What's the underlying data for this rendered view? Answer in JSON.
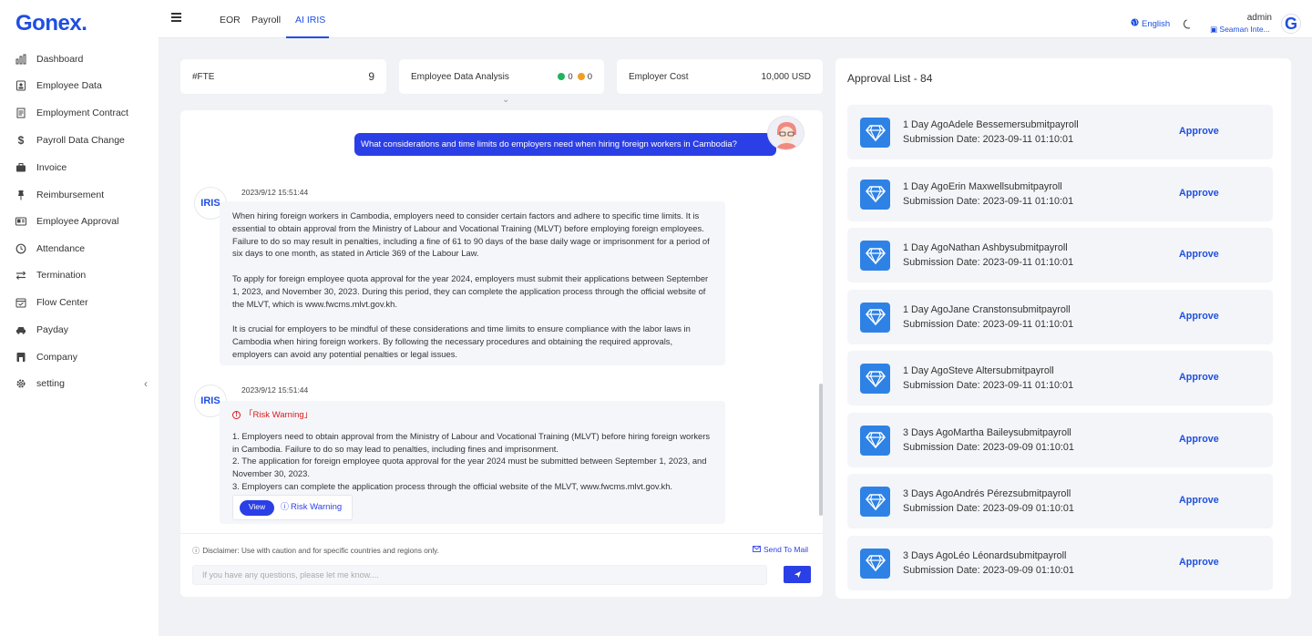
{
  "brand": {
    "name": "Gonex",
    "dot": "."
  },
  "sidebar": {
    "items": [
      {
        "label": "Dashboard",
        "icon": "bar-chart-icon"
      },
      {
        "label": "Employee Data",
        "icon": "id-card-icon"
      },
      {
        "label": "Employment Contract",
        "icon": "document-icon"
      },
      {
        "label": "Payroll Data Change",
        "icon": "dollar-icon"
      },
      {
        "label": "Invoice",
        "icon": "briefcase-icon"
      },
      {
        "label": "Reimbursement",
        "icon": "pin-icon"
      },
      {
        "label": "Employee Approval",
        "icon": "contact-card-icon"
      },
      {
        "label": "Attendance",
        "icon": "clock-icon"
      },
      {
        "label": "Termination",
        "icon": "swap-icon"
      },
      {
        "label": "Flow Center",
        "icon": "calendar-check-icon"
      },
      {
        "label": "Payday",
        "icon": "car-icon"
      },
      {
        "label": "Company",
        "icon": "building-icon"
      },
      {
        "label": "setting",
        "icon": "gear-icon"
      }
    ],
    "collapse_glyph": "‹"
  },
  "topbar": {
    "tabs": [
      {
        "label": "EOR"
      },
      {
        "label": "Payroll"
      },
      {
        "label": "AI IRIS",
        "active": true
      }
    ],
    "language": "English",
    "user_name": "admin",
    "user_company": "Seaman Inte...",
    "avatar_letter": "G"
  },
  "stats": {
    "fte_label": "#FTE",
    "fte_value": "9",
    "analysis_label": "Employee Data Analysis",
    "green_count": "0",
    "orange_count": "0",
    "cost_label": "Employer Cost",
    "cost_value": "10,000 USD",
    "expand_glyph": "⌄"
  },
  "chat": {
    "question": "What considerations and time limits do employers need when hiring foreign workers in Cambodia?",
    "bot_name": "IRIS",
    "messages": [
      {
        "timestamp": "2023/9/12 15:51:44",
        "paragraphs": [
          "When hiring foreign workers in Cambodia, employers need to consider certain factors and adhere to specific time limits. It is essential to obtain approval from the Ministry of Labour and Vocational Training (MLVT) before employing foreign employees. Failure to do so may result in penalties, including a fine of 61 to 90 days of the base daily wage or imprisonment for a period of six days to one month, as stated in Article 369 of the Labour Law.",
          "To apply for foreign employee quota approval for the year 2024, employers must submit their applications between September 1, 2023, and November 30, 2023. During this period, they can complete the application process through the official website of the MLVT, which is www.fwcms.mlvt.gov.kh.",
          "It is crucial for employers to be mindful of these considerations and time limits to ensure compliance with the labor laws in Cambodia when hiring foreign workers. By following the necessary procedures and obtaining the required approvals, employers can avoid any potential penalties or legal issues."
        ]
      },
      {
        "timestamp": "2023/9/12 15:51:44",
        "risk_title": "「Risk Warning」",
        "risk_lines": [
          "1. Employers need to obtain approval from the Ministry of Labour and Vocational Training (MLVT) before hiring foreign workers in Cambodia. Failure to do so may lead to penalties, including fines and imprisonment.",
          "2. The application for foreign employee quota approval for the year 2024 must be submitted between September 1, 2023, and November 30, 2023.",
          "3. Employers can complete the application process through the official website of the MLVT, www.fwcms.mlvt.gov.kh."
        ],
        "view_label": "View",
        "risk_link_label": "Risk Warning"
      }
    ],
    "disclaimer": "Disclaimer: Use with caution and for specific countries and regions only.",
    "send_mail": "Send To Mail",
    "input_placeholder": "If you have any questions, please let me know...."
  },
  "approval": {
    "title": "Approval List - 84",
    "approve_label": "Approve",
    "items": [
      {
        "line1": "1 Day AgoAdele Bessemersubmitpayroll",
        "line2": "Submission Date: 2023-09-11 01:10:01"
      },
      {
        "line1": "1 Day AgoErin Maxwellsubmitpayroll",
        "line2": "Submission Date: 2023-09-11 01:10:01"
      },
      {
        "line1": "1 Day AgoNathan Ashbysubmitpayroll",
        "line2": "Submission Date: 2023-09-11 01:10:01"
      },
      {
        "line1": "1 Day AgoJane Cranstonsubmitpayroll",
        "line2": "Submission Date: 2023-09-11 01:10:01"
      },
      {
        "line1": "1 Day AgoSteve Altersubmitpayroll",
        "line2": "Submission Date: 2023-09-11 01:10:01"
      },
      {
        "line1": "3 Days AgoMartha Baileysubmitpayroll",
        "line2": "Submission Date: 2023-09-09 01:10:01"
      },
      {
        "line1": "3 Days AgoAndrés Pérezsubmitpayroll",
        "line2": "Submission Date: 2023-09-09 01:10:01"
      },
      {
        "line1": "3 Days AgoLéo Léonardsubmitpayroll",
        "line2": "Submission Date: 2023-09-09 01:10:01"
      }
    ]
  },
  "colors": {
    "accent": "#1f4fe0",
    "bubble": "#2b3fe6",
    "approval_icon": "#2e82e6",
    "risk": "#d91b1b",
    "green": "#22b35e",
    "orange": "#f0a020"
  }
}
